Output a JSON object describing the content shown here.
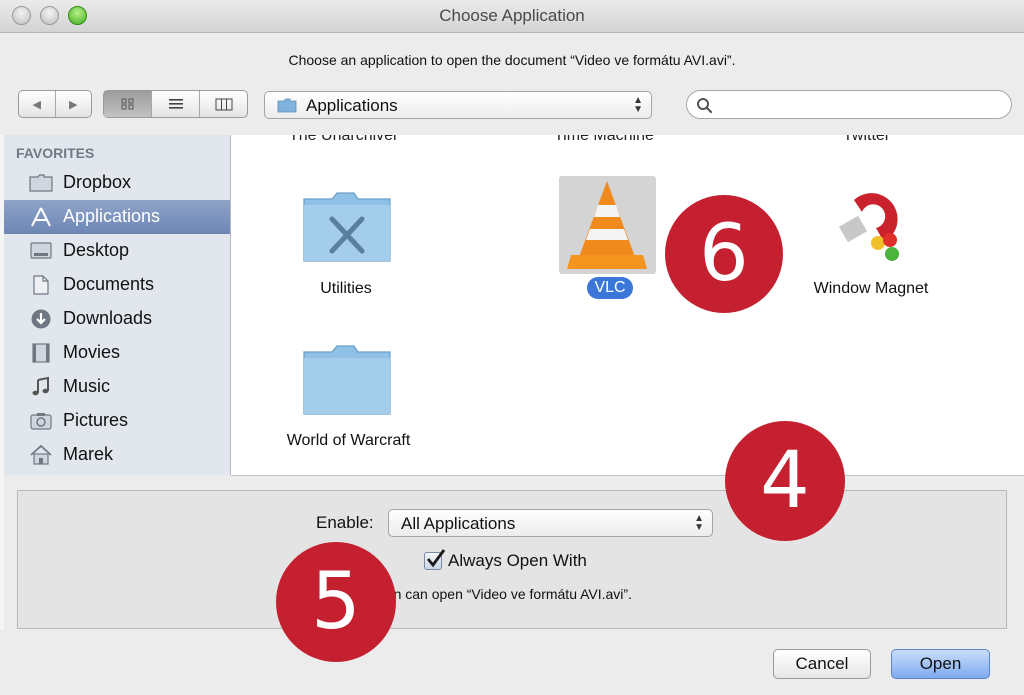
{
  "window": {
    "title": "Choose Application"
  },
  "prompt": "Choose an application to open the document “Video ve formátu AVI.avi”.",
  "toolbar": {
    "back": "◀",
    "forward": "▶",
    "location": "Applications",
    "search_placeholder": ""
  },
  "sidebar": {
    "header": "FAVORITES",
    "items": [
      {
        "label": "Dropbox",
        "icon": "folder-icon"
      },
      {
        "label": "Applications",
        "icon": "applications-icon",
        "selected": true
      },
      {
        "label": "Desktop",
        "icon": "desktop-icon"
      },
      {
        "label": "Documents",
        "icon": "documents-icon"
      },
      {
        "label": "Downloads",
        "icon": "downloads-icon"
      },
      {
        "label": "Movies",
        "icon": "movies-icon"
      },
      {
        "label": "Music",
        "icon": "music-icon"
      },
      {
        "label": "Pictures",
        "icon": "pictures-icon"
      },
      {
        "label": "Marek",
        "icon": "home-icon"
      }
    ]
  },
  "browser": {
    "partial_row": [
      "The Unarchiver",
      "Time Machine",
      "Twitter"
    ],
    "apps": [
      {
        "name": "Utilities",
        "icon": "utilities-folder-icon"
      },
      {
        "name": "VLC",
        "icon": "vlc-cone-icon",
        "selected": true
      },
      {
        "name": "Window Magnet",
        "icon": "magnet-icon"
      },
      {
        "name": "World of Warcraft",
        "icon": "folder-icon"
      }
    ]
  },
  "options": {
    "enable_label": "Enable:",
    "enable_value": "All Applications",
    "always_open_label": "Always Open With",
    "always_open_checked": true,
    "info": "ation can open “Video ve formátu AVI.avi”."
  },
  "buttons": {
    "cancel": "Cancel",
    "open": "Open"
  },
  "badges": [
    "6",
    "4",
    "5"
  ],
  "colors": {
    "badge": "#c5202f",
    "selection": "#3a77d8",
    "sidebar_selected": "#7b91bd"
  }
}
